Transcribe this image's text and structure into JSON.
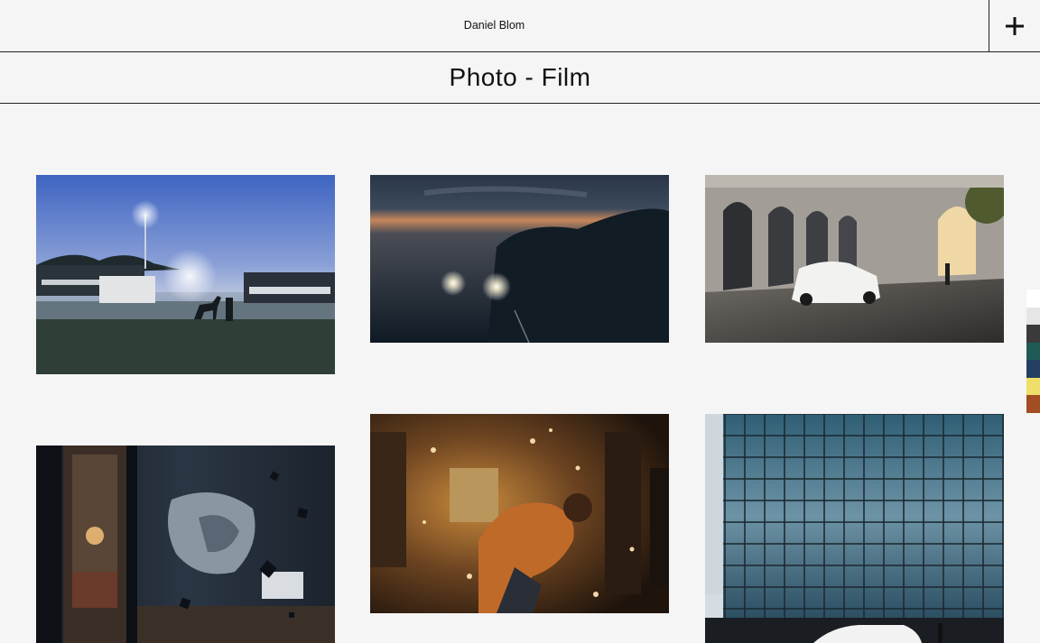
{
  "header": {
    "site_name": "Daniel Blom",
    "menu_icon": "plus-icon"
  },
  "page": {
    "title": "Photo - Film"
  },
  "gallery": {
    "items": [
      {
        "name": "photo-horse-stable-night",
        "icon": "photo"
      },
      {
        "name": "photo-car-headlights-dusk",
        "icon": "photo"
      },
      {
        "name": "photo-white-suv-colonnade",
        "icon": "photo"
      },
      {
        "name": "photo-wall-explosion",
        "icon": "photo"
      },
      {
        "name": "photo-person-falling-papers",
        "icon": "photo"
      },
      {
        "name": "photo-glass-building-car",
        "icon": "photo"
      }
    ]
  },
  "palette": {
    "colors": [
      "#ffffff",
      "#e6e6e6",
      "#3a3a3a",
      "#1f5a55",
      "#233f63",
      "#efdf6a",
      "#a24d23"
    ]
  }
}
